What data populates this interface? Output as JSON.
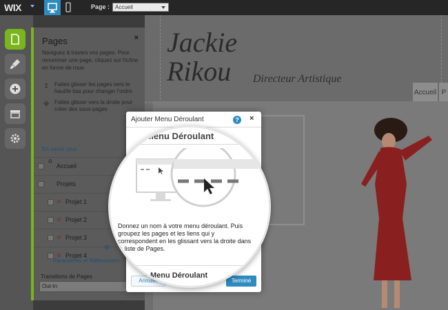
{
  "topbar": {
    "logo": "WIX",
    "page_label": "Page :",
    "page_value": "Accueil"
  },
  "site": {
    "name_first": "Jackie",
    "name_last": "Rikou",
    "role": "Directeur Artistique",
    "nav": [
      "Accueil",
      "P"
    ]
  },
  "pages_panel": {
    "title": "Pages",
    "close": "×",
    "description": "Naviguez à travers vos pages. Pour renommer une page, cliquez sur l'icône en forme de roue.",
    "tips": [
      "Faites glisser les pages vers le haut/le bas pour changer l'ordre",
      "Faites glisser vers la droite pour créer des sous-pages"
    ],
    "learn_more": "En savoir plus",
    "items": [
      {
        "label": "Accueil"
      },
      {
        "label": "Projets"
      },
      {
        "label": "Projet 1"
      },
      {
        "label": "Projet 2"
      },
      {
        "label": "Projet 3"
      },
      {
        "label": "Projet 4"
      }
    ],
    "params_link": "Paramètres et Référencem",
    "transitions_label": "Transitions de Pages",
    "transitions_value": "Out-In"
  },
  "modal": {
    "title": "Ajouter Menu Déroulant",
    "help": "?",
    "close": "×",
    "cancel": "Annuler",
    "done": "Terminé"
  },
  "magnifier": {
    "heading": "Menu Déroulant",
    "description": "Donnez un nom à votre menu déroulant. Puis groupez les pages et les liens qui y correspondent en les glissant vers la droite dans la liste de Pages.",
    "input_label": "Menu Déroulant"
  },
  "colors": {
    "accent_green": "#7ab51d",
    "accent_blue": "#2e8bc0",
    "dress_red": "#8a1f1f"
  },
  "icons": {
    "rail": [
      "pages-icon",
      "design-brush-icon",
      "add-icon",
      "app-market-icon",
      "settings-gear-icon"
    ]
  }
}
